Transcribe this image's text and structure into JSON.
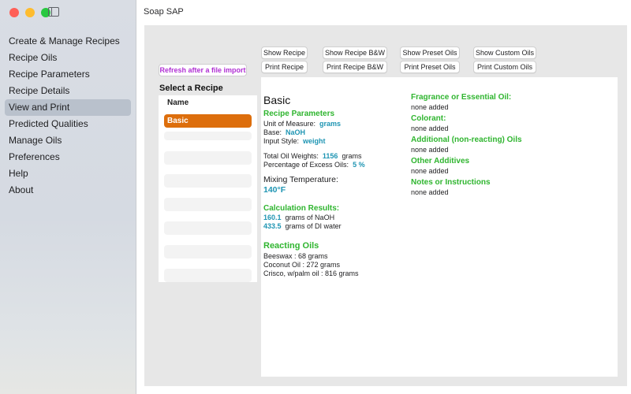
{
  "window": {
    "title": "Soap SAP"
  },
  "sidebar": {
    "items": [
      {
        "label": "Create & Manage Recipes"
      },
      {
        "label": "Recipe Oils"
      },
      {
        "label": "Recipe Parameters"
      },
      {
        "label": "Recipe Details"
      },
      {
        "label": "View and Print",
        "active": true
      },
      {
        "label": "Predicted Qualities"
      },
      {
        "label": "Manage Oils"
      },
      {
        "label": "Preferences"
      },
      {
        "label": "Help"
      },
      {
        "label": "About"
      }
    ]
  },
  "left": {
    "refresh_label": "Refresh after a file import",
    "select_label": "Select a Recipe",
    "list_header": "Name",
    "selected_recipe": "Basic"
  },
  "buttons": {
    "show_recipe": "Show Recipe",
    "show_recipe_bw": "Show Recipe B&W",
    "show_preset_oils": "Show Preset Oils",
    "show_custom_oils": "Show Custom Oils",
    "print_recipe": "Print Recipe",
    "print_recipe_bw": "Print Recipe B&W",
    "print_preset_oils": "Print Preset Oils",
    "print_custom_oils": "Print Custom Oils"
  },
  "recipe": {
    "name": "Basic",
    "params_heading": "Recipe Parameters",
    "unit_label": "Unit of Measure:",
    "unit_value": "grams",
    "base_label": "Base:",
    "base_value": "NaOH",
    "input_label": "Input Style:",
    "input_value": "weight",
    "total_label": "Total Oil Weights:",
    "total_value": "1156",
    "total_unit": "grams",
    "excess_label": "Percentage of Excess Oils:",
    "excess_value": "5 %",
    "mix_label": "Mixing Temperature:",
    "mix_value": "140°F",
    "calc_heading": "Calculation Results:",
    "lye_value": "160.1",
    "lye_text": "grams  of  NaOH",
    "water_value": "433.5",
    "water_text": "grams  of DI water",
    "oils_heading": "Reacting Oils",
    "oils": [
      "Beeswax  :   68  grams",
      "Coconut Oil   :   272  grams",
      "Crisco, w/palm oil   :   816  grams"
    ],
    "fragrance_heading": "Fragrance or Essential Oil:",
    "fragrance_value": "none added",
    "colorant_heading": "Colorant:",
    "colorant_value": "none added",
    "additional_heading": "Additional (non-reacting) Oils",
    "additional_value": "none added",
    "other_heading": "Other Additives",
    "other_value": "none added",
    "notes_heading": "Notes or Instructions",
    "notes_value": "none added"
  },
  "colors": {
    "accent_orange": "#dd6e0c",
    "heading_green": "#2fb52f",
    "value_teal": "#1f95b3",
    "refresh_purple": "#b02fd4"
  }
}
